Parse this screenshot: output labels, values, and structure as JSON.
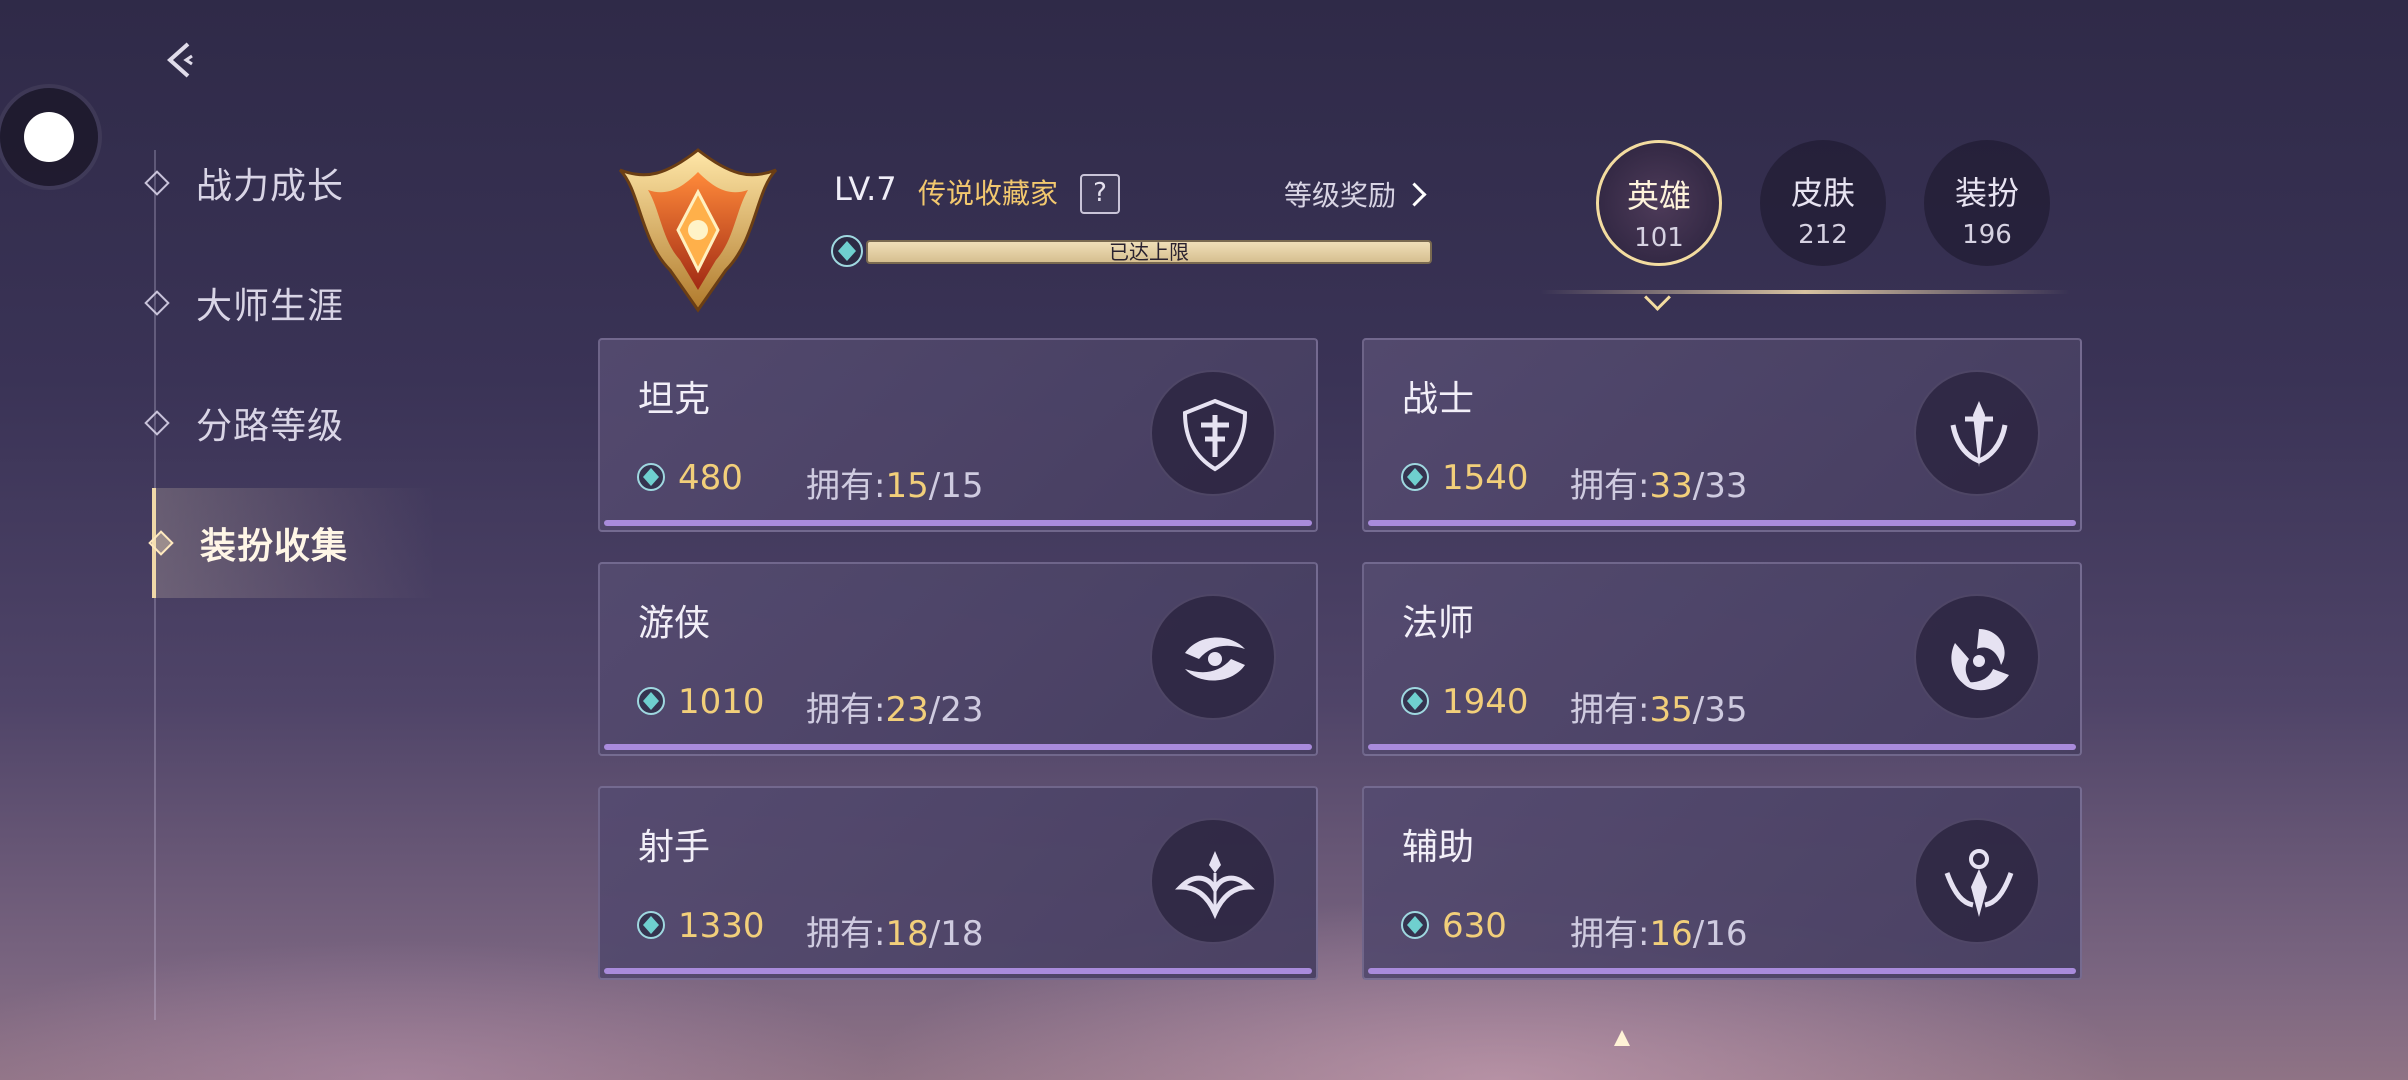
{
  "nav": {
    "items": [
      {
        "label": "战力成长"
      },
      {
        "label": "大师生涯"
      },
      {
        "label": "分路等级"
      },
      {
        "label": "装扮收集"
      }
    ],
    "active": "装扮收集"
  },
  "profile": {
    "level": "LV.7",
    "title": "传说收藏家",
    "help": "?",
    "reward_link": "等级奖励",
    "progress_text": "已达上限",
    "progress": 1.0
  },
  "tabs": [
    {
      "label": "英雄",
      "count": "101",
      "active": true
    },
    {
      "label": "皮肤",
      "count": "212",
      "active": false
    },
    {
      "label": "装扮",
      "count": "196",
      "active": false
    }
  ],
  "roles": [
    {
      "name": "坦克",
      "points": "480",
      "owned_label": "拥有:",
      "owned": "15",
      "total": "/15",
      "icon": "tank-shield-icon"
    },
    {
      "name": "战士",
      "points": "1540",
      "owned_label": "拥有:",
      "owned": "33",
      "total": "/33",
      "icon": "warrior-sword-icon"
    },
    {
      "name": "游侠",
      "points": "1010",
      "owned_label": "拥有:",
      "owned": "23",
      "total": "/23",
      "icon": "ranger-wave-icon"
    },
    {
      "name": "法师",
      "points": "1940",
      "owned_label": "拥有:",
      "owned": "35",
      "total": "/35",
      "icon": "mage-swirl-icon"
    },
    {
      "name": "射手",
      "points": "1330",
      "owned_label": "拥有:",
      "owned": "18",
      "total": "/18",
      "icon": "marksman-bow-icon"
    },
    {
      "name": "辅助",
      "points": "630",
      "owned_label": "拥有:",
      "owned": "16",
      "total": "/16",
      "icon": "support-crest-icon"
    }
  ],
  "colors": {
    "accent_gold": "#f2cf7a",
    "progress_purple": "#a98bdc",
    "tab_ring": "#f3dca0"
  }
}
